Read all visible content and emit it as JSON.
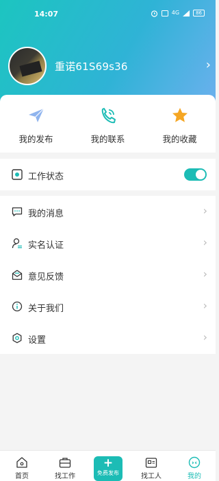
{
  "status_bar": {
    "time": "14:07",
    "icons": [
      "alarm-icon",
      "hd-icon",
      "signal-icon"
    ],
    "signal_label": "4G",
    "battery": "86"
  },
  "profile": {
    "name": "重诺61S69s36"
  },
  "quick_actions": [
    {
      "label": "我的发布",
      "icon": "paper-plane-icon",
      "color": "#7faaea"
    },
    {
      "label": "我的联系",
      "icon": "phone-icon",
      "color": "#1cbcb5"
    },
    {
      "label": "我的收藏",
      "icon": "star-icon",
      "color": "#f5a623"
    }
  ],
  "work_status": {
    "label": "工作状态",
    "enabled": true
  },
  "menu": [
    {
      "label": "我的消息",
      "icon": "message-icon"
    },
    {
      "label": "实名认证",
      "icon": "user-verify-icon"
    },
    {
      "label": "意见反馈",
      "icon": "feedback-icon"
    },
    {
      "label": "关于我们",
      "icon": "info-icon"
    },
    {
      "label": "设置",
      "icon": "settings-icon"
    }
  ],
  "tabbar": {
    "tabs": [
      {
        "label": "首页",
        "icon": "home-icon"
      },
      {
        "label": "找工作",
        "icon": "briefcase-icon"
      },
      {
        "label": "找工人",
        "icon": "worker-icon"
      },
      {
        "label": "我的",
        "icon": "mine-icon",
        "active": true
      }
    ],
    "publish_label": "免费发布"
  },
  "colors": {
    "accent": "#1cbcb5",
    "header_start": "#1cc5c0",
    "header_end": "#6fb0ef"
  }
}
